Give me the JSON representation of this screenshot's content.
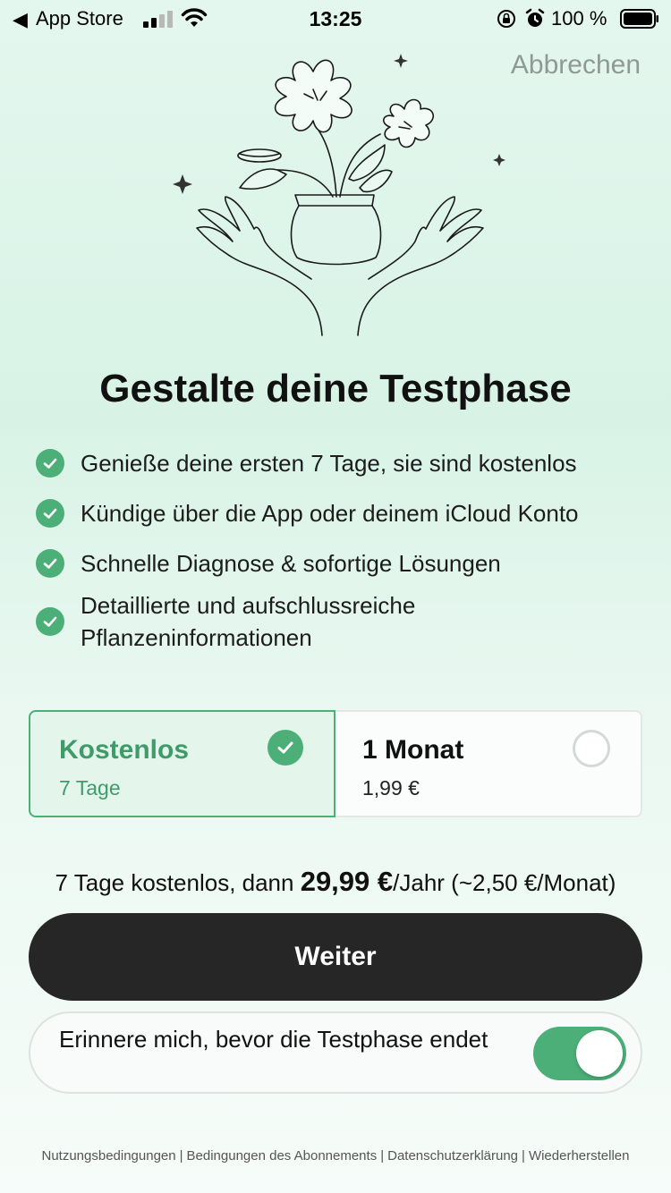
{
  "status_bar": {
    "back_glyph": "◀",
    "back_app": "App Store",
    "time": "13:25",
    "battery_text": "100 %"
  },
  "header": {
    "cancel_label": "Abbrechen"
  },
  "title": "Gestalte deine Testphase",
  "features": [
    "Genieße deine ersten 7 Tage, sie sind kostenlos",
    "Kündige über die App oder deinem iCloud Konto",
    "Schnelle Diagnose & sofortige Lösungen",
    "Detaillierte und aufschlussreiche Pflanzeninformationen"
  ],
  "plans": {
    "free": {
      "name": "Kostenlos",
      "sub": "7 Tage",
      "selected": true
    },
    "month": {
      "name": "1 Monat",
      "sub": "1,99 €",
      "selected": false
    }
  },
  "price_line": {
    "prefix": "7 Tage kostenlos, dann ",
    "price": "29,99 €",
    "suffix": "/Jahr (~2,50 €/Monat)"
  },
  "continue_label": "Weiter",
  "reminder": {
    "text": "Erinnere mich, bevor die Testphase endet",
    "enabled": true
  },
  "footer": {
    "links": [
      "Nutzungsbedingungen",
      "Bedingungen des Abonnements",
      "Datenschutzerklärung",
      "Wiederherstellen"
    ],
    "separator": "|"
  },
  "colors": {
    "accent": "#4caf78",
    "button_dark": "#262626",
    "cancel_gray": "#8e9a93"
  },
  "icons": [
    "back-arrow-icon",
    "cellular-signal-icon",
    "wifi-icon",
    "orientation-lock-icon",
    "alarm-icon",
    "battery-icon",
    "check-icon",
    "radio-icon",
    "plant-hands-illustration",
    "sparkle-icon"
  ]
}
